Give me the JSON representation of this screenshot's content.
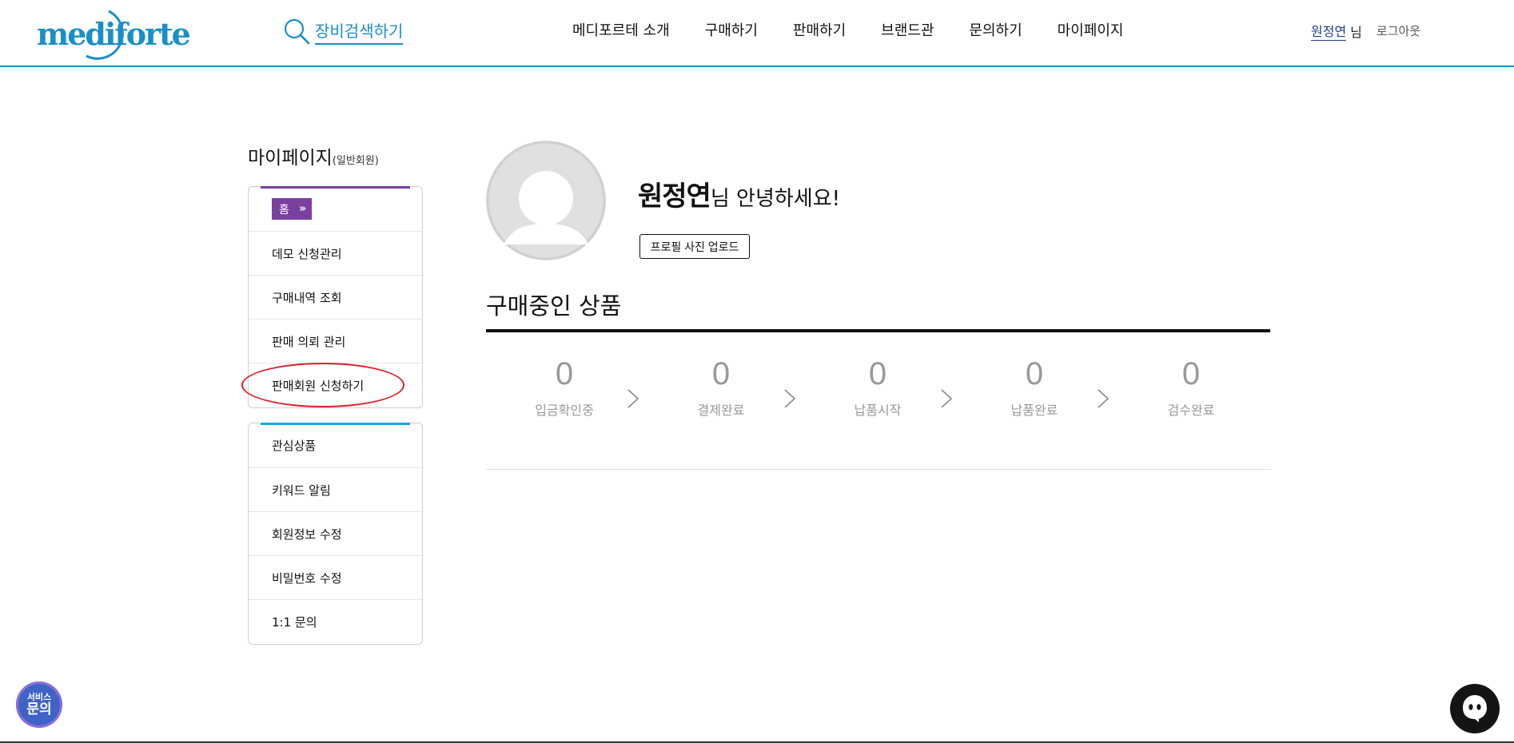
{
  "header": {
    "logo_text": "mediforte",
    "search_label": "장비검색하기",
    "nav": [
      "메디포르테 소개",
      "구매하기",
      "판매하기",
      "브랜드관",
      "문의하기",
      "마이페이지"
    ],
    "user_name": "원정연",
    "user_suffix": "님",
    "logout": "로그아웃"
  },
  "sidebar": {
    "title": "마이페이지",
    "title_sub": "(일반회원)",
    "group1": [
      {
        "label": "홈"
      },
      {
        "label": "데모 신청관리"
      },
      {
        "label": "구매내역 조회"
      },
      {
        "label": "판매 의뢰 관리"
      },
      {
        "label": "판매회원 신청하기"
      }
    ],
    "group2": [
      {
        "label": "관심상품"
      },
      {
        "label": "키워드 알림"
      },
      {
        "label": "회원정보 수정"
      },
      {
        "label": "비밀번호 수정"
      },
      {
        "label": "1:1 문의"
      }
    ],
    "home_chevrons": "»"
  },
  "profile": {
    "name": "원정연",
    "greeting_suffix": "님 안녕하세요!",
    "upload_button": "프로필 사진 업로드"
  },
  "purchases": {
    "title": "구매중인 상품",
    "stages": [
      {
        "count": "0",
        "label": "입금확인중"
      },
      {
        "count": "0",
        "label": "결제완료"
      },
      {
        "count": "0",
        "label": "납품시작"
      },
      {
        "count": "0",
        "label": "납품완료"
      },
      {
        "count": "0",
        "label": "검수완료"
      }
    ]
  },
  "floating": {
    "service_line1": "서비스",
    "service_line2": "문의"
  },
  "colors": {
    "brand_blue": "#1a8fc7",
    "accent_purple": "#7b3fa0",
    "accent_cyan": "#19a8e0",
    "highlight_red": "#d9202a"
  }
}
